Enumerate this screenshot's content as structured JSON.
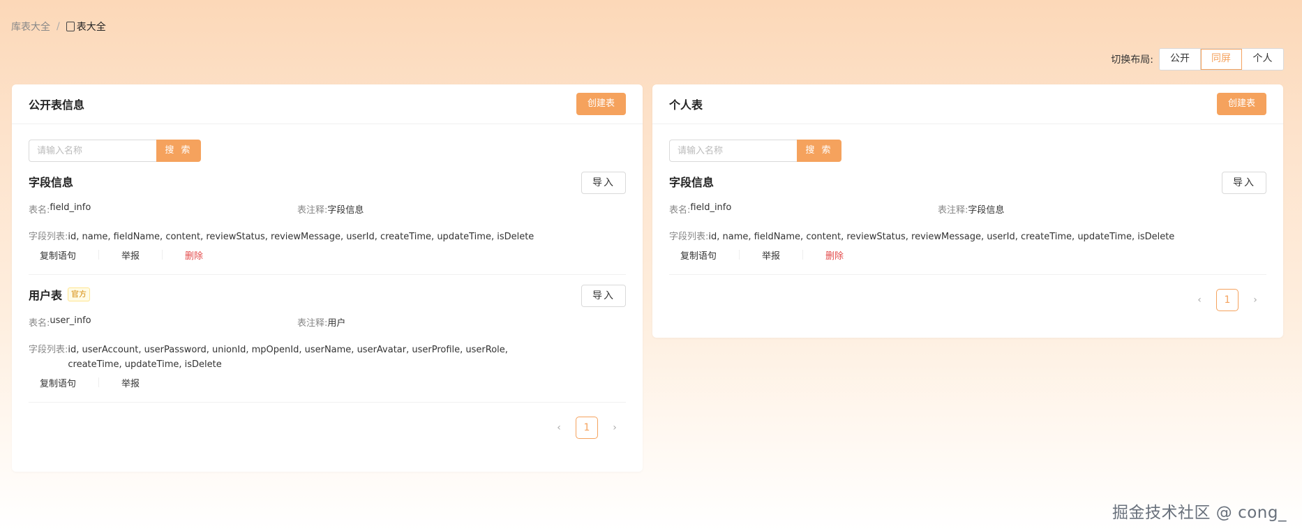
{
  "breadcrumb": {
    "parent": "库表大全",
    "separator": "/",
    "current": "表大全"
  },
  "layout_switch": {
    "label": "切换布局:",
    "options": [
      "公开",
      "同屏",
      "个人"
    ],
    "selected": "同屏"
  },
  "public_panel": {
    "title": "公开表信息",
    "create_label": "创建表",
    "search": {
      "placeholder": "请输入名称",
      "button": "搜 索"
    },
    "items": [
      {
        "title": "字段信息",
        "tag": "",
        "import_label": "导入",
        "table_name_label": "表名:",
        "table_name": "field_info",
        "comment_label": "表注释:",
        "comment": "字段信息",
        "fields_label": "字段列表:",
        "fields": "id, name, fieldName, content, reviewStatus, reviewMessage, userId, createTime, updateTime, isDelete",
        "actions": {
          "copy": "复制语句",
          "report": "举报",
          "delete": "删除"
        }
      },
      {
        "title": "用户表",
        "tag": "官方",
        "import_label": "导入",
        "table_name_label": "表名:",
        "table_name": "user_info",
        "comment_label": "表注释:",
        "comment": "用户",
        "fields_label": "字段列表:",
        "fields": "id, userAccount, userPassword, unionId, mpOpenId, userName, userAvatar, userProfile, userRole, createTime, updateTime, isDelete",
        "actions": {
          "copy": "复制语句",
          "report": "举报"
        }
      }
    ],
    "pagination": {
      "current": "1",
      "prev": "‹",
      "next": "›"
    }
  },
  "personal_panel": {
    "title": "个人表",
    "create_label": "创建表",
    "search": {
      "placeholder": "请输入名称",
      "button": "搜 索"
    },
    "items": [
      {
        "title": "字段信息",
        "import_label": "导入",
        "table_name_label": "表名:",
        "table_name": "field_info",
        "comment_label": "表注释:",
        "comment": "字段信息",
        "fields_label": "字段列表:",
        "fields": "id, name, fieldName, content, reviewStatus, reviewMessage, userId, createTime, updateTime, isDelete",
        "actions": {
          "copy": "复制语句",
          "report": "举报",
          "delete": "删除"
        }
      }
    ],
    "pagination": {
      "current": "1",
      "prev": "‹",
      "next": "›"
    }
  },
  "watermark": "掘金技术社区 @ cong_",
  "colors": {
    "accent": "#f5a25d",
    "danger": "#e34b4b",
    "tag": "#d48806"
  }
}
